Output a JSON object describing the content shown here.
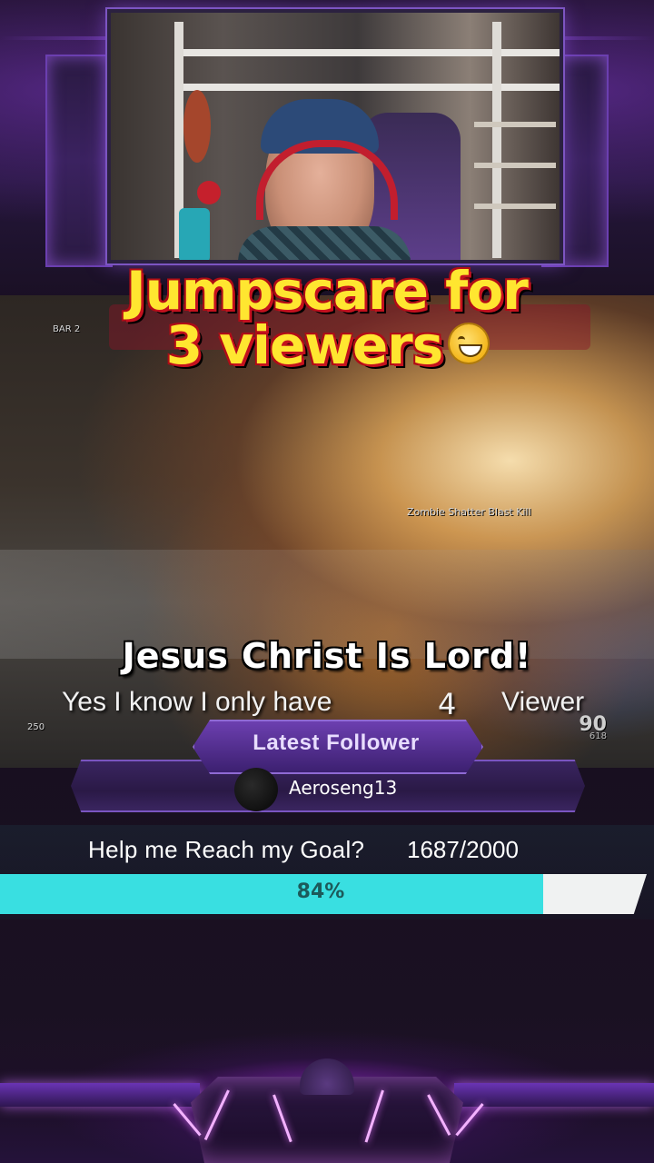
{
  "caption": {
    "line1": "Jumpscare for",
    "line2": "3 viewers",
    "emoji_icon": "sweat-smile-emoji"
  },
  "game_hud": {
    "kill_feed": "Zombie Shatter Blast Kill",
    "top_left_label": "BAR 2",
    "ammo": "90",
    "ammo_reserve": "618",
    "left_value": "250"
  },
  "overlay": {
    "banner": "Jesus Christ Is Lord!",
    "viewer_text": "Yes I know I only have",
    "viewer_count": "4",
    "viewer_unit": "Viewer"
  },
  "follower_widget": {
    "title": "Latest Follower",
    "name": "Aeroseng13"
  },
  "goal": {
    "label": "Help me Reach my Goal?",
    "count": "1687/2000",
    "percent_label": "84%",
    "progress_fraction": 0.84,
    "fill_color": "#39dfe1"
  },
  "theme": {
    "accent": "#8a4bdc",
    "caption_color": "#ffe630",
    "caption_outline": "#c4121e"
  }
}
